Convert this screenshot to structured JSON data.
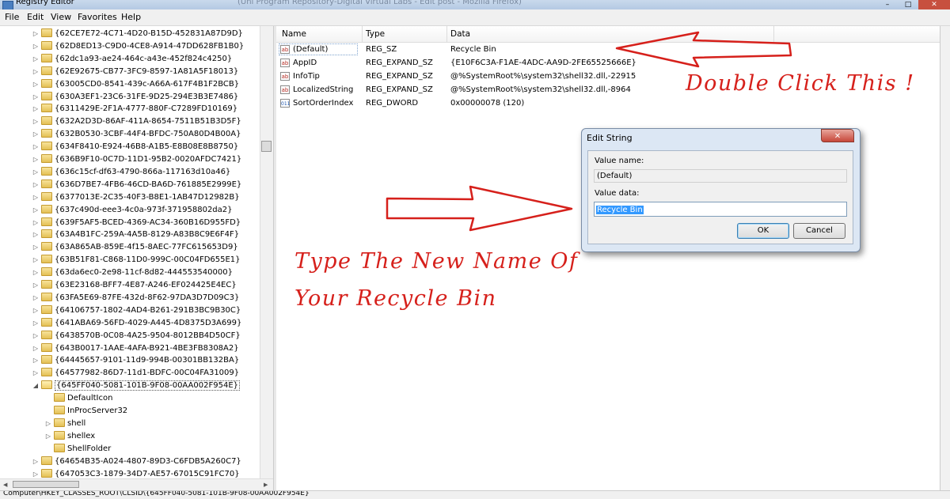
{
  "window": {
    "title": "Registry Editor",
    "title_extra": "(Uni Program Repository-Digital Virtual Labs - Edit post - Mozilla Firefox)",
    "close_label": "✕"
  },
  "menu": [
    "File",
    "Edit",
    "View",
    "Favorites",
    "Help"
  ],
  "tree": {
    "keys": [
      "{62CE7E72-4C71-4D20-B15D-452831A87D9D}",
      "{62D8ED13-C9D0-4CE8-A914-47DD628FB1B0}",
      "{62dc1a93-ae24-464c-a43e-452f824c4250}",
      "{62E92675-CB77-3FC9-8597-1A81A5F18013}",
      "{63005CD0-8541-439c-A66A-617F4B1F2BCB}",
      "{630A3EF1-23C6-31FE-9D25-294E3B3E7486}",
      "{6311429E-2F1A-4777-880F-C7289FD10169}",
      "{632A2D3D-86AF-411A-8654-7511B51B3D5F}",
      "{632B0530-3CBF-44F4-BFDC-750A80D4B00A}",
      "{634F8410-E924-46B8-A1B5-E8B08E8B8750}",
      "{636B9F10-0C7D-11D1-95B2-0020AFDC7421}",
      "{636c15cf-df63-4790-866a-117163d10a46}",
      "{636D7BE7-4FB6-46CD-BA6D-761885E2999E}",
      "{6377013E-2C35-40F3-B8E1-1AB47D12982B}",
      "{637c490d-eee3-4c0a-973f-371958802da2}",
      "{639F5AF5-BCED-4369-AC34-360B16D955FD}",
      "{63A4B1FC-259A-4A5B-8129-A83B8C9E6F4F}",
      "{63A865AB-859E-4f15-8AEC-77FC615653D9}",
      "{63B51F81-C868-11D0-999C-00C04FD655E1}",
      "{63da6ec0-2e98-11cf-8d82-444553540000}",
      "{63E23168-BFF7-4E87-A246-EF024425E4EC}",
      "{63FA5E69-87FE-432d-8F62-97DA3D7D09C3}",
      "{64106757-1802-4AD4-B261-291B3BC9B30C}",
      "{641ABA69-56FD-4029-A445-4D8375D3A699}",
      "{6438570B-0C08-4A25-9504-8012BB4D50CF}",
      "{643B0017-1AAE-4AFA-B921-4BE3FB8308A2}",
      "{64445657-9101-11d9-994B-00301BB132BA}",
      "{64577982-86D7-11d1-BDFC-00C04FA31009}"
    ],
    "expanded_key": "{645FF040-5081-101B-9F08-00AA002F954E}",
    "subkeys": [
      "DefaultIcon",
      "InProcServer32",
      "shell",
      "shellex",
      "ShellFolder"
    ],
    "after_keys": [
      "{64654B35-A024-4807-89D3-C6FDB5A260C7}",
      "{647053C3-1879-34D7-AE57-67015C91FC70}"
    ]
  },
  "list": {
    "headers": {
      "name": "Name",
      "type": "Type",
      "data": "Data"
    },
    "rows": [
      {
        "name": "(Default)",
        "type": "REG_SZ",
        "data": "Recycle Bin",
        "icon": "ab"
      },
      {
        "name": "AppID",
        "type": "REG_EXPAND_SZ",
        "data": "{E10F6C3A-F1AE-4ADC-AA9D-2FE65525666E}",
        "icon": "ab"
      },
      {
        "name": "InfoTip",
        "type": "REG_EXPAND_SZ",
        "data": "@%SystemRoot%\\system32\\shell32.dll,-22915",
        "icon": "ab"
      },
      {
        "name": "LocalizedString",
        "type": "REG_EXPAND_SZ",
        "data": "@%SystemRoot%\\system32\\shell32.dll,-8964",
        "icon": "ab"
      },
      {
        "name": "SortOrderIndex",
        "type": "REG_DWORD",
        "data": "0x00000078 (120)",
        "icon": "011"
      }
    ]
  },
  "dialog": {
    "title": "Edit String",
    "value_name_label": "Value name:",
    "value_name": "(Default)",
    "value_data_label": "Value data:",
    "value_data": "Recycle Bin",
    "ok": "OK",
    "cancel": "Cancel",
    "close": "✕"
  },
  "annotations": {
    "double_click": "Double Click This !",
    "type_line1": "Type The New Name Of",
    "type_line2": "Your Recycle Bin",
    "color": "#d6201b"
  },
  "status": "Computer\\HKEY_CLASSES_ROOT\\CLSID\\{645FF040-5081-101B-9F08-00AA002F954E}"
}
